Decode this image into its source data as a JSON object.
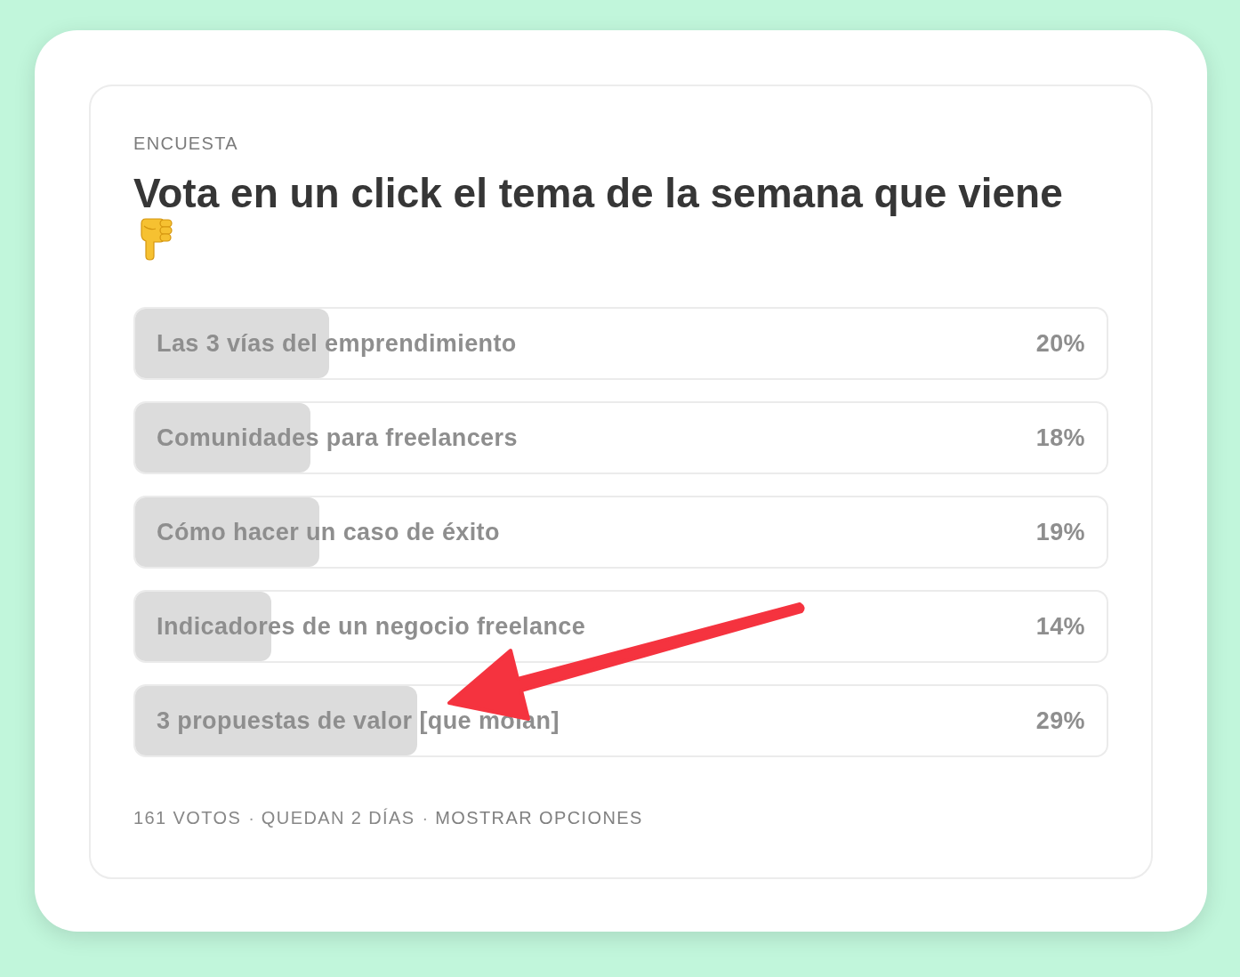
{
  "poll": {
    "label": "ENCUESTA",
    "title": "Vota en un click el tema de la semana que viene",
    "options": [
      {
        "text": "Las 3 vías del emprendimiento",
        "percent": "20%",
        "level": 0.2
      },
      {
        "text": "Comunidades para freelancers",
        "percent": "18%",
        "level": 0.18
      },
      {
        "text": "Cómo hacer un caso de éxito",
        "percent": "19%",
        "level": 0.19
      },
      {
        "text": "Indicadores de un negocio freelance",
        "percent": "14%",
        "level": 0.14
      },
      {
        "text": "3 propuestas de valor [que molan]",
        "percent": "29%",
        "level": 0.29
      }
    ],
    "footer": [
      {
        "kind": "text",
        "text": "161 VOTOS"
      },
      {
        "kind": "separator",
        "text": "·"
      },
      {
        "kind": "text",
        "text": "QUEDAN 2 DÍAS"
      },
      {
        "kind": "separator",
        "text": "·"
      },
      {
        "kind": "link",
        "text": "MOSTRAR OPCIONES"
      }
    ]
  }
}
